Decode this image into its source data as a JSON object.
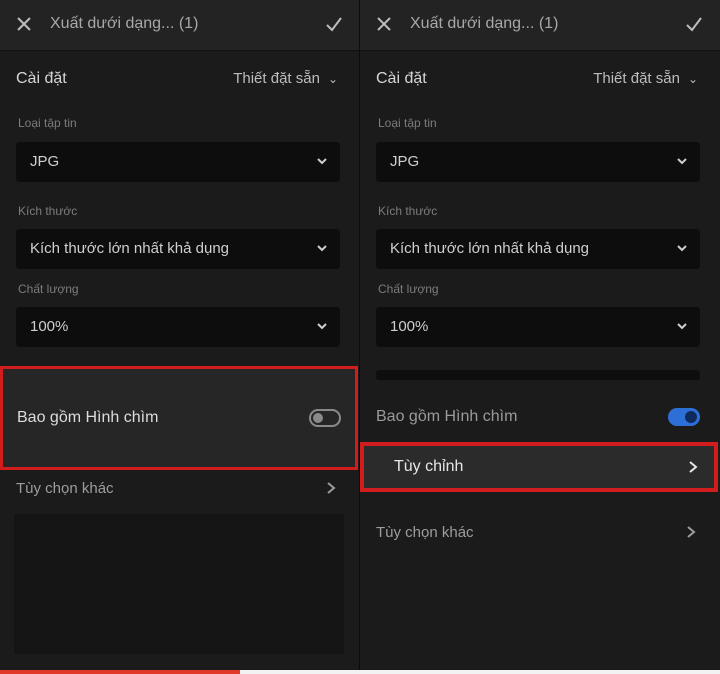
{
  "left": {
    "header": {
      "title": "Xuất dưới dạng... (1)"
    },
    "settings": {
      "label": "Cài đặt",
      "preset": "Thiết đặt sẵn"
    },
    "file_type": {
      "label": "Loại tập tin",
      "value": "JPG"
    },
    "size": {
      "label": "Kích thước",
      "value": "Kích thước lớn nhất khả dụng"
    },
    "quality": {
      "label": "Chất lượng",
      "value": "100%"
    },
    "watermark": {
      "label": "Bao gồm Hình chìm",
      "enabled": false
    },
    "more_options": {
      "label": "Tùy chọn khác"
    }
  },
  "right": {
    "header": {
      "title": "Xuất dưới dạng... (1)"
    },
    "settings": {
      "label": "Cài đặt",
      "preset": "Thiết đặt sẵn"
    },
    "file_type": {
      "label": "Loại tập tin",
      "value": "JPG"
    },
    "size": {
      "label": "Kích thước",
      "value": "Kích thước lớn nhất khả dụng"
    },
    "quality": {
      "label": "Chất lượng",
      "value": "100%"
    },
    "watermark": {
      "label": "Bao gồm Hình chìm",
      "enabled": true
    },
    "customize": {
      "label": "Tùy chỉnh"
    },
    "more_options": {
      "label": "Tùy chọn khác"
    }
  },
  "colors": {
    "highlight": "#d11d1d",
    "toggle_on": "#2d6fd6",
    "background": "#1b1b1b"
  },
  "icons": {
    "close": "close-icon",
    "confirm": "checkmark-icon",
    "dropdown": "chevron-down-icon",
    "next": "chevron-right-icon"
  }
}
